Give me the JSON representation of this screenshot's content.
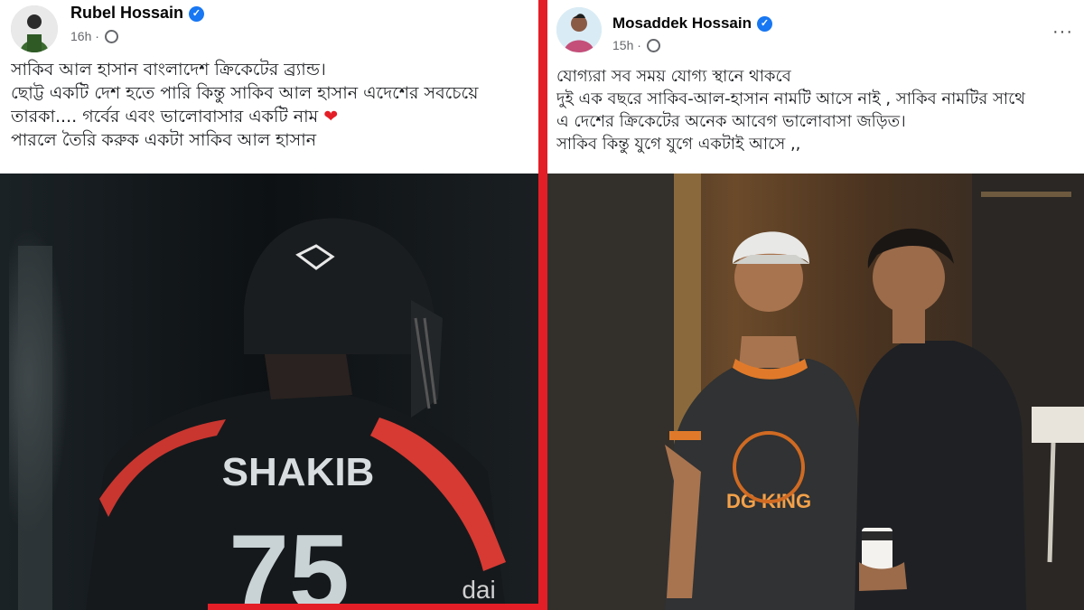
{
  "left_post": {
    "author": "Rubel Hossain",
    "time": "16h",
    "lines": [
      "সাকিব আল হাসান বাংলাদেশ ক্রিকেটের ব্র্যান্ড।",
      "ছোট্ট একটি দেশ হতে পারি কিন্তু সাকিব আল হাসান এদেশের সবচেয়ে",
      "তারকা.... গর্বের এবং ভালোবাসার একটি নাম",
      "পারলে তৈরি করুক একটা সাকিব আল হাসান"
    ],
    "heart": "❤",
    "jersey_name": "SHAKIB",
    "jersey_number": "75",
    "sponsor": "dai"
  },
  "right_post": {
    "author": "Mosaddek Hossain",
    "time": "15h",
    "more": "···",
    "lines": [
      "যোগ্যরা সব সময় যোগ্য স্থানে থাকবে",
      "দুই  এক বছরে সাকিব-আল-হাসান নামটি আসে নাই , সাকিব  নামটির সাথে",
      "এ দেশের ক্রিকেটের অনেক আবেগ ভালোবাসা জড়িত।",
      "সাকিব কিন্তু যুগে যুগে একটাই আসে ,,"
    ],
    "shirt_text": "DG KING"
  },
  "colors": {
    "divider": "#e41e26",
    "verified": "#1877f2",
    "meta": "#65676b"
  }
}
